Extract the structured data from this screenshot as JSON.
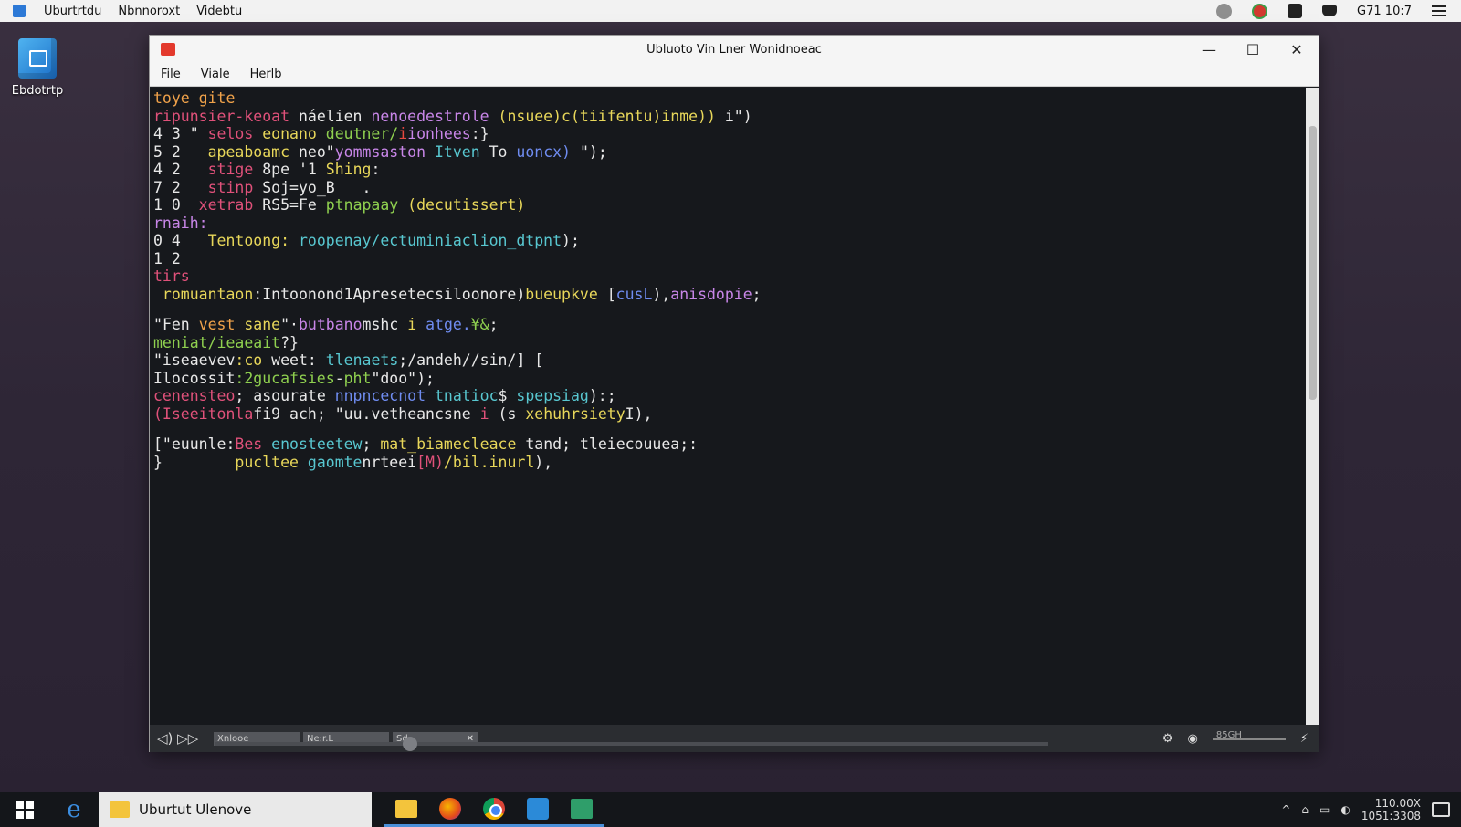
{
  "topbar": {
    "menu": [
      "Uburtrtdu",
      "Nbnnoroxt",
      "Videbtu"
    ],
    "clock": "G71 10:7"
  },
  "desktop": {
    "icon_label": "Ebdotrtp"
  },
  "window": {
    "title": "Ubluoto Vin Lner Wonidnoeac",
    "menu": [
      "File",
      "Viale",
      "Herlb"
    ],
    "controls": {
      "minimize": "—",
      "maximize": "☐",
      "close": "✕"
    }
  },
  "editor": {
    "colors": {
      "pink": "#e0517a",
      "orange": "#f0a24a",
      "yellow": "#e8d75a",
      "green": "#8fd04f",
      "cyan": "#58c7d0",
      "blue": "#6f8cf0",
      "purple": "#c886e8",
      "white": "#e8e8e8",
      "red": "#e4483f"
    },
    "lines": [
      {
        "gap": "",
        "parts": [
          {
            "t": "toye gite",
            "c": "orange"
          }
        ]
      },
      {
        "gap": "",
        "parts": [
          {
            "t": "ripunsier-keoat ",
            "c": "pink"
          },
          {
            "t": "náelien ",
            "c": "white"
          },
          {
            "t": "nenoedestrole ",
            "c": "purple"
          },
          {
            "t": "(nsuee)c(tiifentu)inme)) ",
            "c": "yellow"
          },
          {
            "t": "i\")",
            "c": "white"
          }
        ]
      },
      {
        "gap": "",
        "parts": [
          {
            "t": "4 3 \" ",
            "c": "white"
          },
          {
            "t": "selos ",
            "c": "pink"
          },
          {
            "t": "eonano ",
            "c": "yellow"
          },
          {
            "t": "deutner/",
            "c": "green"
          },
          {
            "t": "i",
            "c": "red"
          },
          {
            "t": "ionhees",
            "c": "purple"
          },
          {
            "t": ":}",
            "c": "white"
          }
        ]
      },
      {
        "gap": "",
        "parts": [
          {
            "t": "5 2   ",
            "c": "white"
          },
          {
            "t": "apeaboamc ",
            "c": "yellow"
          },
          {
            "t": "neo\"",
            "c": "white"
          },
          {
            "t": "yommsaston ",
            "c": "purple"
          },
          {
            "t": "Itven ",
            "c": "cyan"
          },
          {
            "t": "To ",
            "c": "white"
          },
          {
            "t": "uoncx)",
            "c": "blue"
          },
          {
            "t": " \");",
            "c": "white"
          }
        ]
      },
      {
        "gap": "",
        "parts": [
          {
            "t": "4 2   ",
            "c": "white"
          },
          {
            "t": "stige ",
            "c": "pink"
          },
          {
            "t": "8pe ",
            "c": "white"
          },
          {
            "t": "'1 ",
            "c": "white"
          },
          {
            "t": "Shing",
            "c": "yellow"
          },
          {
            "t": ":",
            "c": "white"
          }
        ]
      },
      {
        "gap": "",
        "parts": [
          {
            "t": "7 2   ",
            "c": "white"
          },
          {
            "t": "stinp ",
            "c": "pink"
          },
          {
            "t": "Soj=yo_B   .",
            "c": "white"
          }
        ]
      },
      {
        "gap": "",
        "parts": [
          {
            "t": "1 0  ",
            "c": "white"
          },
          {
            "t": "xetrab ",
            "c": "pink"
          },
          {
            "t": "RS5=Fe ",
            "c": "white"
          },
          {
            "t": "ptnapaay ",
            "c": "green"
          },
          {
            "t": "(decutissert)",
            "c": "yellow"
          }
        ]
      },
      {
        "gap": "",
        "parts": [
          {
            "t": "rnaih:",
            "c": "purple"
          }
        ]
      },
      {
        "gap": "",
        "parts": [
          {
            "t": "0 4   ",
            "c": "white"
          },
          {
            "t": "Tentoong: ",
            "c": "yellow"
          },
          {
            "t": "roopenay/ectuminiaclion_dtpnt",
            "c": "cyan"
          },
          {
            "t": ");",
            "c": "white"
          }
        ]
      },
      {
        "gap": "",
        "parts": [
          {
            "t": "1 2",
            "c": "white"
          }
        ]
      },
      {
        "gap": "",
        "parts": [
          {
            "t": "tirs",
            "c": "pink"
          }
        ]
      },
      {
        "gap": "",
        "parts": [
          {
            "t": " romuantaon",
            "c": "yellow"
          },
          {
            "t": ":Intoonond1Apresetecsiloonore)",
            "c": "white"
          },
          {
            "t": "bueupkve ",
            "c": "yellow"
          },
          {
            "t": "[",
            "c": "white"
          },
          {
            "t": "cusL",
            "c": "blue"
          },
          {
            "t": "),",
            "c": "white"
          },
          {
            "t": "anisdopie",
            "c": "purple"
          },
          {
            "t": ";",
            "c": "white"
          }
        ]
      },
      {
        "gap": "gap",
        "parts": [
          {
            "t": "\"",
            "c": "white"
          },
          {
            "t": "Fen ",
            "c": "white"
          },
          {
            "t": "vest ",
            "c": "orange"
          },
          {
            "t": "sane",
            "c": "yellow"
          },
          {
            "t": "\"",
            "c": "white"
          },
          {
            "t": "·",
            "c": "white"
          },
          {
            "t": "butbano",
            "c": "purple"
          },
          {
            "t": "mshc ",
            "c": "white"
          },
          {
            "t": "i ",
            "c": "yellow"
          },
          {
            "t": "atge.",
            "c": "blue"
          },
          {
            "t": "¥&",
            "c": "green"
          },
          {
            "t": ";",
            "c": "white"
          }
        ]
      },
      {
        "gap": "",
        "parts": [
          {
            "t": "meniat/ieaeait",
            "c": "green"
          },
          {
            "t": "?}",
            "c": "white"
          }
        ]
      },
      {
        "gap": "",
        "parts": [
          {
            "t": "\"iseaevev",
            "c": "white"
          },
          {
            "t": ":co ",
            "c": "yellow"
          },
          {
            "t": "weet",
            "c": "white"
          },
          {
            "t": ": ",
            "c": "white"
          },
          {
            "t": "tlenaets",
            "c": "cyan"
          },
          {
            "t": ";/andeh//sin/] ",
            "c": "white"
          },
          {
            "t": "[",
            "c": "white"
          }
        ]
      },
      {
        "gap": "",
        "parts": [
          {
            "t": "Ilocossit",
            "c": "white"
          },
          {
            "t": ":2gucafsies",
            "c": "green"
          },
          {
            "t": "-",
            "c": "white"
          },
          {
            "t": "pht",
            "c": "green"
          },
          {
            "t": "\"doo\");",
            "c": "white"
          }
        ]
      },
      {
        "gap": "",
        "parts": [
          {
            "t": "cenensteo",
            "c": "pink"
          },
          {
            "t": "; ",
            "c": "white"
          },
          {
            "t": "asourate ",
            "c": "white"
          },
          {
            "t": "nnpncecnot ",
            "c": "blue"
          },
          {
            "t": "tnatioc",
            "c": "cyan"
          },
          {
            "t": "$ ",
            "c": "white"
          },
          {
            "t": "spepsiag",
            "c": "cyan"
          },
          {
            "t": "):;",
            "c": "white"
          }
        ]
      },
      {
        "gap": "",
        "parts": [
          {
            "t": "(Iseeitonla",
            "c": "pink"
          },
          {
            "t": "fi9 ",
            "c": "white"
          },
          {
            "t": "ach; ",
            "c": "white"
          },
          {
            "t": "\"uu.",
            "c": "white"
          },
          {
            "t": "vetheancsne ",
            "c": "white"
          },
          {
            "t": "i ",
            "c": "pink"
          },
          {
            "t": "(s ",
            "c": "white"
          },
          {
            "t": "xehuhrsiety",
            "c": "yellow"
          },
          {
            "t": "I),",
            "c": "white"
          }
        ]
      },
      {
        "gap": "gap",
        "parts": [
          {
            "t": "[\"euunle:",
            "c": "white"
          },
          {
            "t": "Bes ",
            "c": "pink"
          },
          {
            "t": "enosteetew",
            "c": "cyan"
          },
          {
            "t": "; ",
            "c": "white"
          },
          {
            "t": "mat_biamecleace ",
            "c": "yellow"
          },
          {
            "t": "tand",
            "c": "white"
          },
          {
            "t": "; ",
            "c": "white"
          },
          {
            "t": "tleiecouuea",
            "c": "white"
          },
          {
            "t": ";:",
            "c": "white"
          }
        ]
      },
      {
        "gap": "",
        "parts": [
          {
            "t": "}        ",
            "c": "white"
          },
          {
            "t": "pucltee ",
            "c": "yellow"
          },
          {
            "t": "gaomte",
            "c": "cyan"
          },
          {
            "t": "nrteei",
            "c": "white"
          },
          {
            "t": "[M)",
            "c": "pink"
          },
          {
            "t": "/bil.inurl",
            "c": "yellow"
          },
          {
            "t": "),",
            "c": "white"
          }
        ]
      }
    ]
  },
  "statusbar": {
    "left": "◁) ▷▷",
    "tabs": [
      "Xnlooe",
      "Ne:r.L",
      "Sd..."
    ],
    "close": "✕",
    "volume_label": "85GH",
    "icons": [
      "settings-icon",
      "audio-icon",
      "expand-icon"
    ]
  },
  "taskbar": {
    "active_label": "Uburtut Ulenove",
    "tray_time": "110.00X",
    "tray_date": "1051:3308"
  }
}
